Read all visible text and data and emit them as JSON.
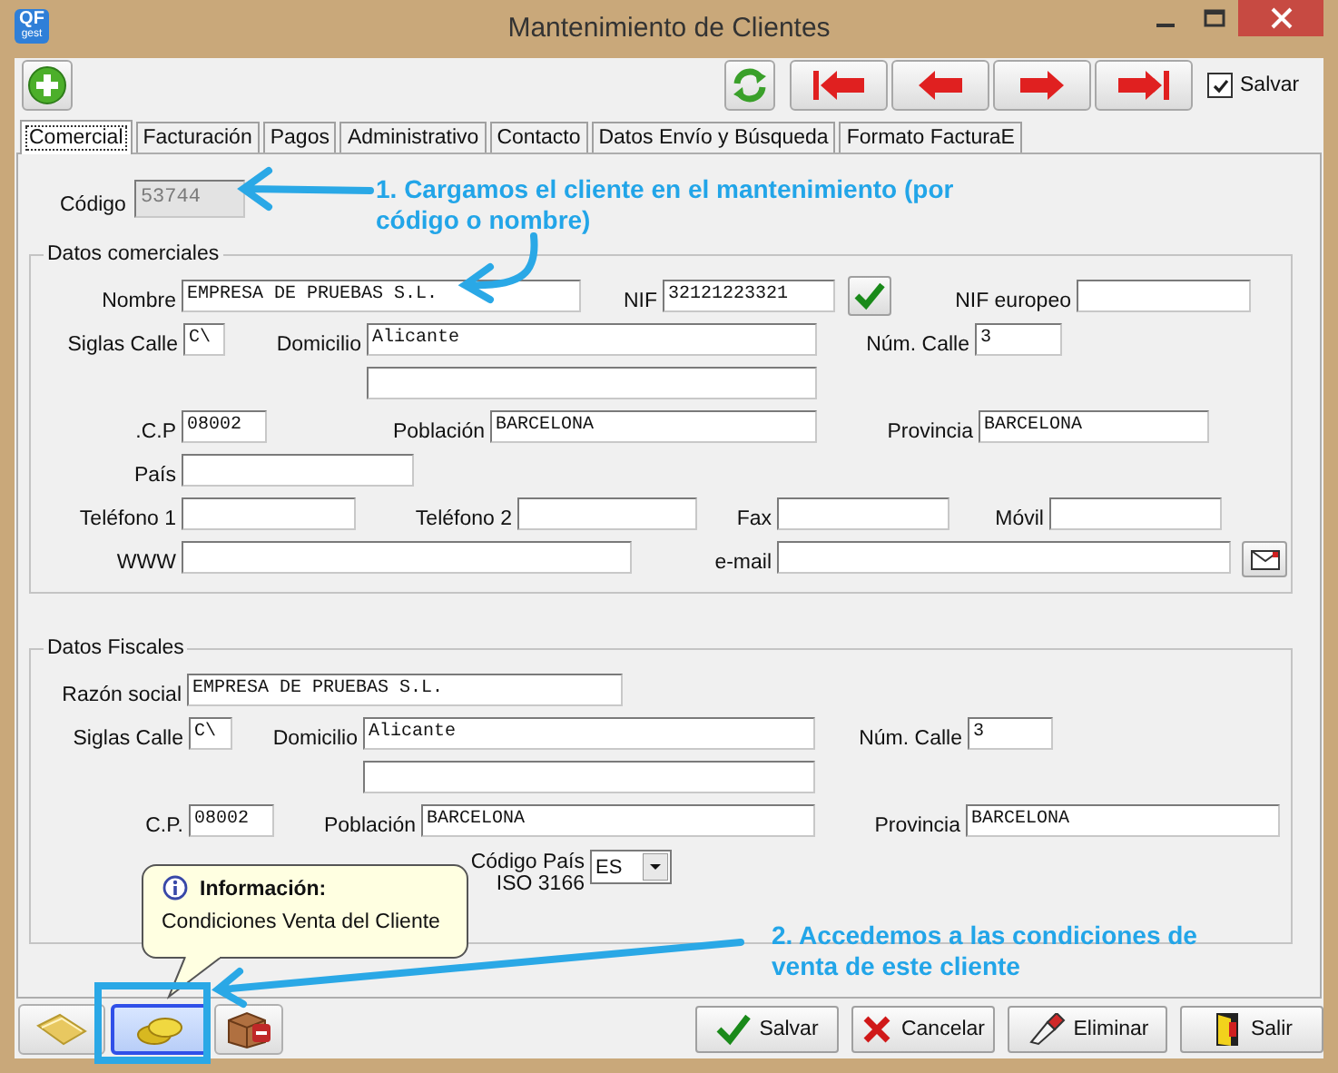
{
  "window": {
    "title": "Mantenimiento de Clientes",
    "logo_lines": [
      "QF",
      "gest"
    ]
  },
  "toolbar": {
    "save_checkbox": {
      "label": "Salvar",
      "checked": true
    }
  },
  "tabs": [
    {
      "label": "Comercial",
      "selected": true
    },
    {
      "label": "Facturación",
      "selected": false
    },
    {
      "label": "Pagos",
      "selected": false
    },
    {
      "label": "Administrativo",
      "selected": false
    },
    {
      "label": "Contacto",
      "selected": false
    },
    {
      "label": "Datos Envío y Búsqueda",
      "selected": false
    },
    {
      "label": "Formato FacturaE",
      "selected": false
    }
  ],
  "codigo": {
    "label": "Código",
    "value": "53744",
    "disabled": true
  },
  "sections": [
    {
      "title": "Datos comerciales",
      "rows": [
        [
          {
            "kind": "field",
            "label": "Nombre",
            "value": "EMPRESA DE PRUEBAS S.L."
          },
          {
            "kind": "field",
            "label": "NIF",
            "value": "32121223321"
          },
          {
            "kind": "field",
            "label": "NIF europeo"
          }
        ],
        [
          {
            "kind": "field",
            "label": "Siglas Calle",
            "value": "C\\"
          },
          {
            "kind": "field",
            "label": "Domicilio",
            "value": "Alicante"
          },
          {
            "kind": "field",
            "label": "Núm. Calle",
            "value": "3"
          }
        ],
        [
          {
            "kind": "field"
          }
        ],
        [
          {
            "kind": "field",
            "label": ".C.P",
            "value": "08002"
          },
          {
            "kind": "field",
            "label": "Población",
            "value": "BARCELONA"
          },
          {
            "kind": "field",
            "label": "Provincia",
            "value": "BARCELONA"
          }
        ],
        [
          {
            "kind": "field",
            "label": "País"
          }
        ],
        [
          {
            "kind": "field",
            "label": "Teléfono 1"
          },
          {
            "kind": "field",
            "label": "Teléfono 2"
          },
          {
            "kind": "field",
            "label": "Fax"
          },
          {
            "kind": "field",
            "label": "Móvil"
          }
        ],
        [
          {
            "kind": "field",
            "label": "WWW"
          },
          {
            "kind": "field",
            "label": "e-mail"
          }
        ]
      ]
    },
    {
      "title": "Datos Fiscales",
      "rows": [
        [
          {
            "kind": "field",
            "label": "Razón social",
            "value": "EMPRESA DE PRUEBAS S.L."
          }
        ],
        [
          {
            "kind": "field",
            "label": "Siglas Calle",
            "value": "C\\"
          },
          {
            "kind": "field",
            "label": "Domicilio",
            "value": "Alicante"
          },
          {
            "kind": "field",
            "label": "Núm. Calle",
            "value": "3"
          }
        ],
        [
          {
            "kind": "field"
          }
        ],
        [
          {
            "kind": "field",
            "label": "C.P.",
            "value": "08002"
          },
          {
            "kind": "field",
            "label": "Población",
            "value": "BARCELONA"
          },
          {
            "kind": "field",
            "label": "Provincia",
            "value": "BARCELONA"
          }
        ],
        [
          {
            "kind": "select",
            "label_lines": [
              "Código País",
              "ISO 3166"
            ],
            "value": "ES"
          }
        ]
      ]
    }
  ],
  "tooltip": {
    "title": "Información:",
    "text": "Condiciones Venta del Cliente"
  },
  "side_buttons": [
    {
      "kind": "folder",
      "selected": false
    },
    {
      "kind": "coins",
      "selected": true
    },
    {
      "kind": "box",
      "selected": false
    }
  ],
  "buttons": [
    {
      "kind": "save",
      "label": "Salvar"
    },
    {
      "kind": "cancel",
      "label": "Cancelar"
    },
    {
      "kind": "delete",
      "label": "Eliminar"
    },
    {
      "kind": "exit",
      "label": "Salir"
    }
  ],
  "annotations": [
    {
      "text": "1. Cargamos el cliente en el mantenimiento (por código o nombre)"
    },
    {
      "text": "2. Accedemos a las condiciones de venta de este cliente"
    }
  ]
}
